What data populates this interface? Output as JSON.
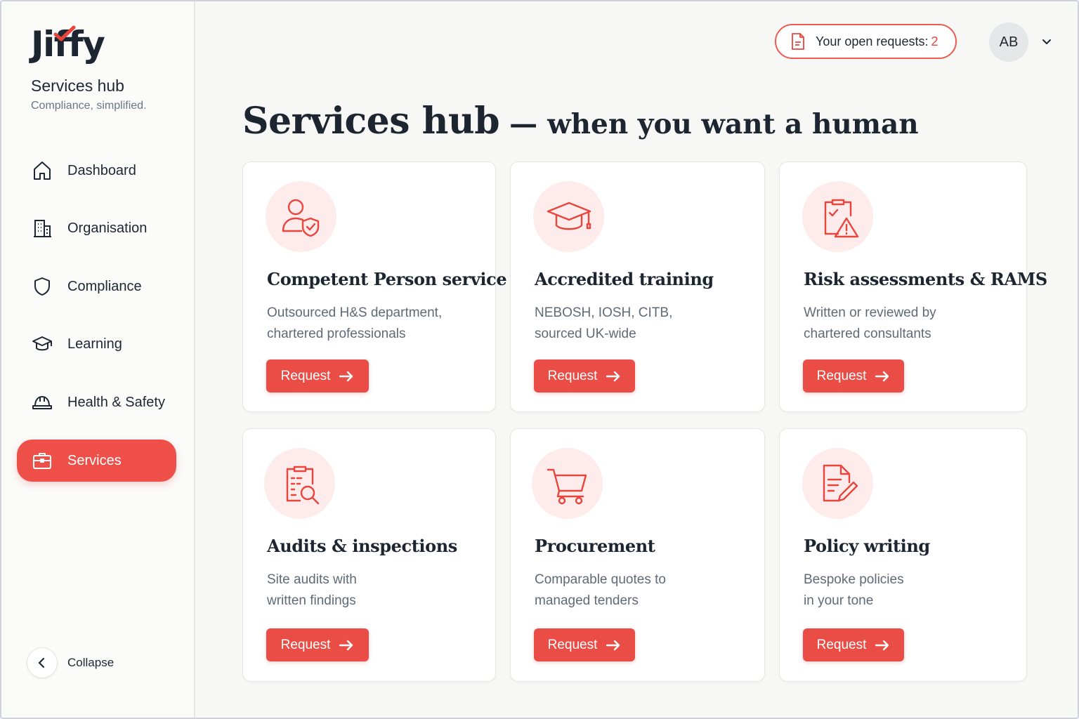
{
  "brand": {
    "name": "Jiffy",
    "subtitle": "Services hub",
    "tagline": "Compliance, simplified."
  },
  "colors": {
    "accent": "#ea4d46",
    "accent_soft": "#fdeceb",
    "text_dark": "#1c2530",
    "text_muted": "#5f6a76"
  },
  "sidebar": {
    "items": [
      {
        "label": "Dashboard",
        "icon": "home-icon",
        "active": false
      },
      {
        "label": "Organisation",
        "icon": "building-icon",
        "active": false
      },
      {
        "label": "Compliance",
        "icon": "shield-icon",
        "active": false
      },
      {
        "label": "Learning",
        "icon": "graduation-cap-icon",
        "active": false
      },
      {
        "label": "Health & Safety",
        "icon": "hard-hat-icon",
        "active": false
      },
      {
        "label": "Services",
        "icon": "briefcase-icon",
        "active": true
      }
    ],
    "collapse_label": "Collapse"
  },
  "header": {
    "open_requests_label": "Your open requests:",
    "open_requests_count": "2",
    "avatar_initials": "AB"
  },
  "page": {
    "title": "Services hub",
    "dash": "—",
    "subtitle": "when you want a human"
  },
  "cards": [
    {
      "title": "Competent Person service",
      "desc_line1": "Outsourced H&S department,",
      "desc_line2": "chartered professionals",
      "button": "Request",
      "icon": "person-shield-icon"
    },
    {
      "title": "Accredited training",
      "desc_line1": "NEBOSH, IOSH, CITB,",
      "desc_line2": "sourced UK-wide",
      "button": "Request",
      "icon": "graduation-cap-icon"
    },
    {
      "title": "Risk assessments & RAMS",
      "desc_line1": "Written or reviewed by",
      "desc_line2": "chartered consultants",
      "button": "Request",
      "icon": "clipboard-warning-icon"
    },
    {
      "title": "Audits & inspections",
      "desc_line1": "Site audits with",
      "desc_line2": "written findings",
      "button": "Request",
      "icon": "clipboard-search-icon"
    },
    {
      "title": "Procurement",
      "desc_line1": "Comparable quotes to",
      "desc_line2": "managed tenders",
      "button": "Request",
      "icon": "shopping-cart-icon"
    },
    {
      "title": "Policy writing",
      "desc_line1": "Bespoke policies",
      "desc_line2": "in your tone",
      "button": "Request",
      "icon": "document-pen-icon"
    }
  ]
}
